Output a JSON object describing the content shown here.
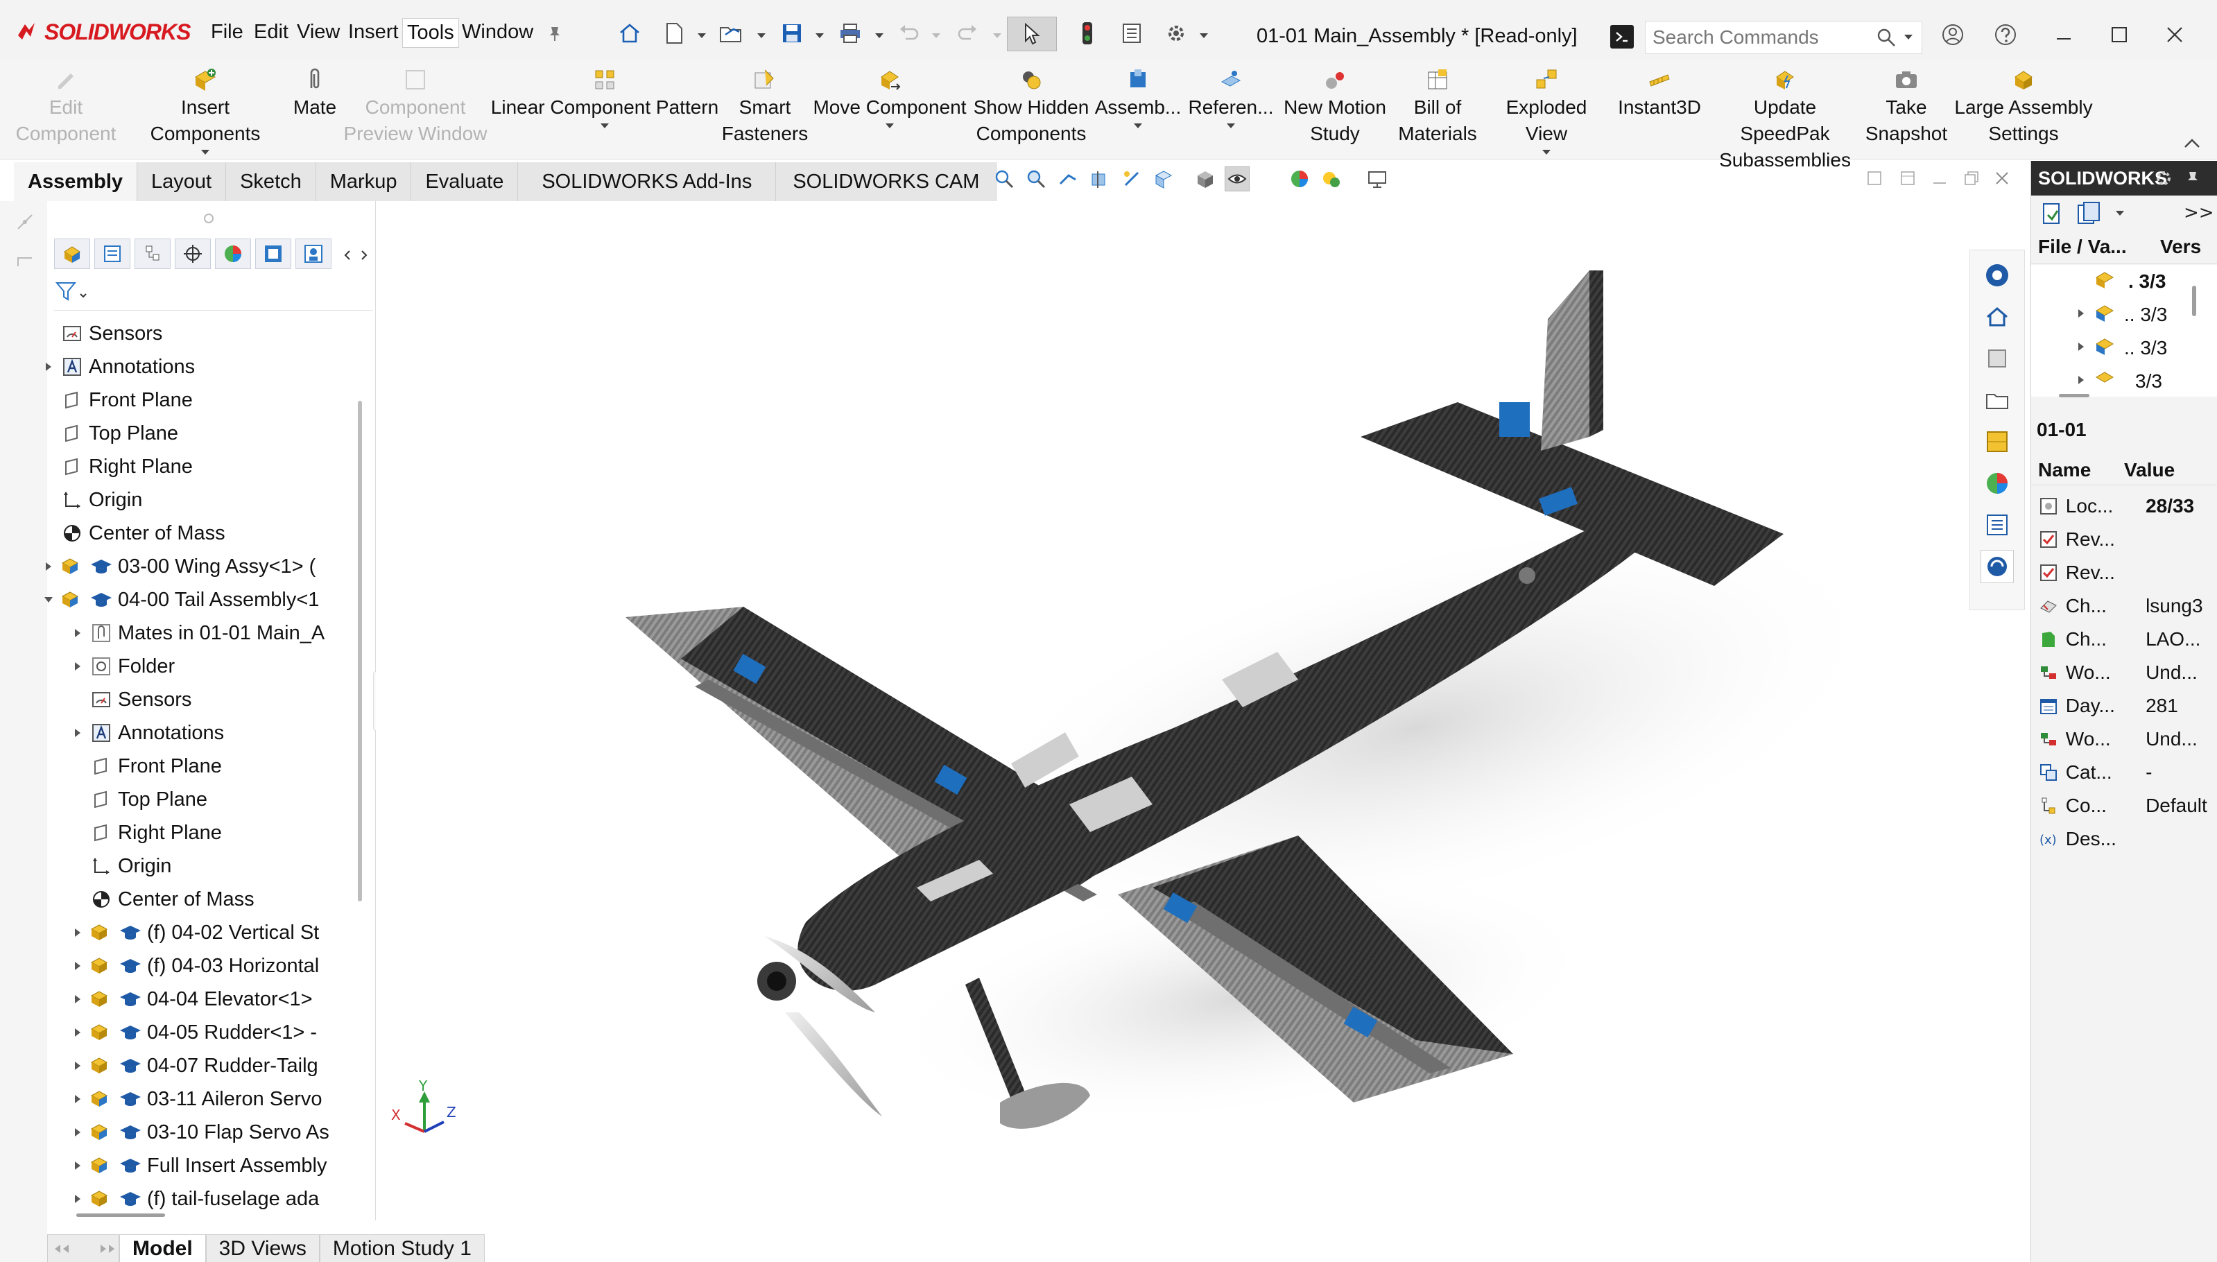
{
  "app": {
    "logo_text": "SOLIDWORKS",
    "document_title": "01-01 Main_Assembly * [Read-only]"
  },
  "menu": [
    "File",
    "Edit",
    "View",
    "Insert",
    "Tools",
    "Window"
  ],
  "menu_active": "Tools",
  "search": {
    "placeholder": "Search Commands"
  },
  "command_manager": [
    {
      "label1": "Edit",
      "label2": "Component",
      "disabled": true
    },
    {
      "label1": "Insert Components",
      "label2": "",
      "disabled": false
    },
    {
      "label1": "Mate",
      "label2": "",
      "disabled": false
    },
    {
      "label1": "Component",
      "label2": "Preview Window",
      "disabled": true
    },
    {
      "label1": "Linear Component Pattern",
      "label2": "",
      "disabled": false
    },
    {
      "label1": "Smart",
      "label2": "Fasteners",
      "disabled": false
    },
    {
      "label1": "Move Component",
      "label2": "",
      "disabled": false
    },
    {
      "label1": "Show Hidden",
      "label2": "Components",
      "disabled": false
    },
    {
      "label1": "Assemb...",
      "label2": "",
      "disabled": false
    },
    {
      "label1": "Referen...",
      "label2": "",
      "disabled": false
    },
    {
      "label1": "New Motion",
      "label2": "Study",
      "disabled": false
    },
    {
      "label1": "Bill of",
      "label2": "Materials",
      "disabled": false
    },
    {
      "label1": "Exploded View",
      "label2": "",
      "disabled": false
    },
    {
      "label1": "Instant3D",
      "label2": "",
      "disabled": false
    },
    {
      "label1": "Update SpeedPak",
      "label2": "Subassemblies",
      "disabled": false
    },
    {
      "label1": "Take",
      "label2": "Snapshot",
      "disabled": false
    },
    {
      "label1": "Large Assembly",
      "label2": "Settings",
      "disabled": false
    }
  ],
  "tabs": [
    "Assembly",
    "Layout",
    "Sketch",
    "Markup",
    "Evaluate",
    "SOLIDWORKS Add-Ins",
    "SOLIDWORKS CAM"
  ],
  "active_tab": "Assembly",
  "tree": [
    {
      "label": "Sensors",
      "icon": "sensor-icon"
    },
    {
      "label": "Annotations",
      "icon": "annotations-icon"
    },
    {
      "label": "Front Plane",
      "icon": "plane-icon"
    },
    {
      "label": "Top Plane",
      "icon": "plane-icon"
    },
    {
      "label": "Right Plane",
      "icon": "plane-icon"
    },
    {
      "label": "Origin",
      "icon": "origin-icon"
    },
    {
      "label": "Center of Mass",
      "icon": "center-of-mass-icon"
    },
    {
      "label": "03-00 Wing Assy<1> (",
      "icon": "assembly-icon"
    },
    {
      "label": "04-00 Tail Assembly<1",
      "icon": "assembly-icon"
    },
    {
      "label": "Mates in 01-01 Main_A",
      "icon": "mates-icon"
    },
    {
      "label": "Folder",
      "icon": "folder-icon"
    },
    {
      "label": "Sensors",
      "icon": "sensor-icon"
    },
    {
      "label": "Annotations",
      "icon": "annotations-icon"
    },
    {
      "label": "Front Plane",
      "icon": "plane-icon"
    },
    {
      "label": "Top Plane",
      "icon": "plane-icon"
    },
    {
      "label": "Right Plane",
      "icon": "plane-icon"
    },
    {
      "label": "Origin",
      "icon": "origin-icon"
    },
    {
      "label": "Center of Mass",
      "icon": "center-of-mass-icon"
    },
    {
      "label": "(f) 04-02 Vertical St",
      "icon": "part-icon"
    },
    {
      "label": "(f) 04-03 Horizontal",
      "icon": "part-icon"
    },
    {
      "label": "04-04 Elevator<1>",
      "icon": "part-icon"
    },
    {
      "label": "04-05 Rudder<1> -",
      "icon": "part-icon"
    },
    {
      "label": "04-07 Rudder-Tailg",
      "icon": "part-icon"
    },
    {
      "label": "03-11 Aileron Servo",
      "icon": "assembly-icon"
    },
    {
      "label": "03-10 Flap Servo As",
      "icon": "assembly-icon"
    },
    {
      "label": "Full Insert Assembly",
      "icon": "assembly-icon"
    },
    {
      "label": "(f) tail-fuselage ada",
      "icon": "part-icon"
    }
  ],
  "bottom_tabs": [
    "Model",
    "3D Views",
    "Motion Study 1"
  ],
  "active_bottom_tab": "Model",
  "triad": {
    "x": "X",
    "y": "Y",
    "z": "Z"
  },
  "pdm": {
    "header": "SOLIDWORKS",
    "more": ">>",
    "col_file": "File / Va...",
    "col_version": "Vers",
    "versions": [
      ". 3/3",
      ".. 3/3",
      ".. 3/3",
      "3/3"
    ],
    "selected": "01-01",
    "col_name": "Name",
    "col_value": "Value",
    "props": [
      {
        "name": "Loc...",
        "value": "28/33"
      },
      {
        "name": "Rev...",
        "value": ""
      },
      {
        "name": "Rev...",
        "value": ""
      },
      {
        "name": "Ch...",
        "value": "lsung3"
      },
      {
        "name": "Ch...",
        "value": "LAO..."
      },
      {
        "name": "Wo...",
        "value": "Und..."
      },
      {
        "name": "Day...",
        "value": "281"
      },
      {
        "name": "Wo...",
        "value": "Und..."
      },
      {
        "name": "Cat...",
        "value": "-"
      },
      {
        "name": "Co...",
        "value": "Default"
      },
      {
        "name": "Des...",
        "value": ""
      }
    ]
  },
  "colors": {
    "brand": "#d71920",
    "accent": "#1a5fb4",
    "carbon": "#3b3b3b"
  }
}
